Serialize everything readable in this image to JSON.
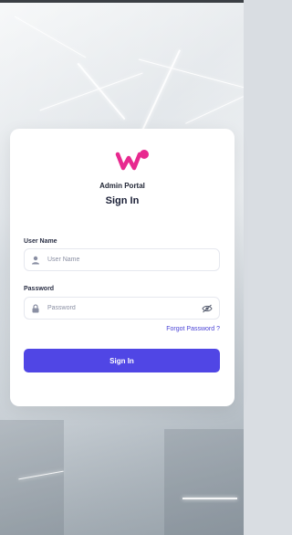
{
  "brand": {
    "logo_icon": "w-heart-logo-icon",
    "portal_name": "Admin Portal"
  },
  "form": {
    "title": "Sign In",
    "username": {
      "label": "User Name",
      "placeholder": "User Name",
      "value": "",
      "icon": "user-icon"
    },
    "password": {
      "label": "Password",
      "placeholder": "Password",
      "value": "",
      "icon": "lock-icon",
      "toggle_icon": "eye-slash-icon"
    },
    "forgot_link": "Forgot Password ?",
    "submit_label": "Sign In"
  },
  "colors": {
    "accent": "#5046e5",
    "brand_pink": "#e8298f",
    "link": "#4b44d6"
  }
}
